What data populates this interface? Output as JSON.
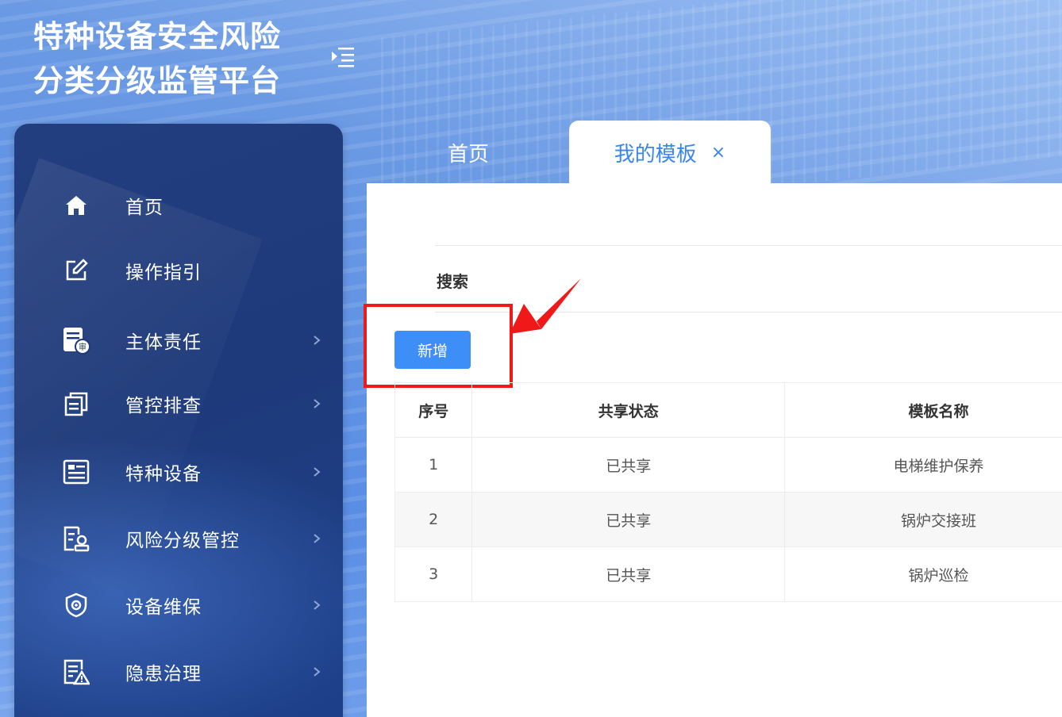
{
  "app": {
    "title_line1": "特种设备安全风险",
    "title_line2": "分类分级监管平台"
  },
  "sidebar": {
    "items": [
      {
        "label": "首页",
        "icon": "home-icon"
      },
      {
        "label": "操作指引",
        "icon": "edit-icon"
      },
      {
        "label": "主体责任",
        "icon": "approval-doc-icon"
      },
      {
        "label": "管控排查",
        "icon": "copy-doc-icon"
      },
      {
        "label": "特种设备",
        "icon": "equipment-list-icon"
      },
      {
        "label": "风险分级管控",
        "icon": "risk-doc-icon"
      },
      {
        "label": "设备维保",
        "icon": "shield-gear-icon"
      },
      {
        "label": "隐患治理",
        "icon": "warning-doc-icon"
      }
    ]
  },
  "tabs": {
    "home": "首页",
    "active": "我的模板",
    "close": "×"
  },
  "main": {
    "search_label": "搜索",
    "add_button": "新增",
    "table": {
      "headers": [
        "序号",
        "共享状态",
        "模板名称"
      ],
      "rows": [
        [
          "1",
          "已共享",
          "电梯维护保养"
        ],
        [
          "2",
          "已共享",
          "锅炉交接班"
        ],
        [
          "3",
          "已共享",
          "锅炉巡检"
        ]
      ]
    }
  },
  "colors": {
    "accent": "#3e8ef7",
    "highlight": "#f01818",
    "sidebar": "#1e3a7a"
  }
}
